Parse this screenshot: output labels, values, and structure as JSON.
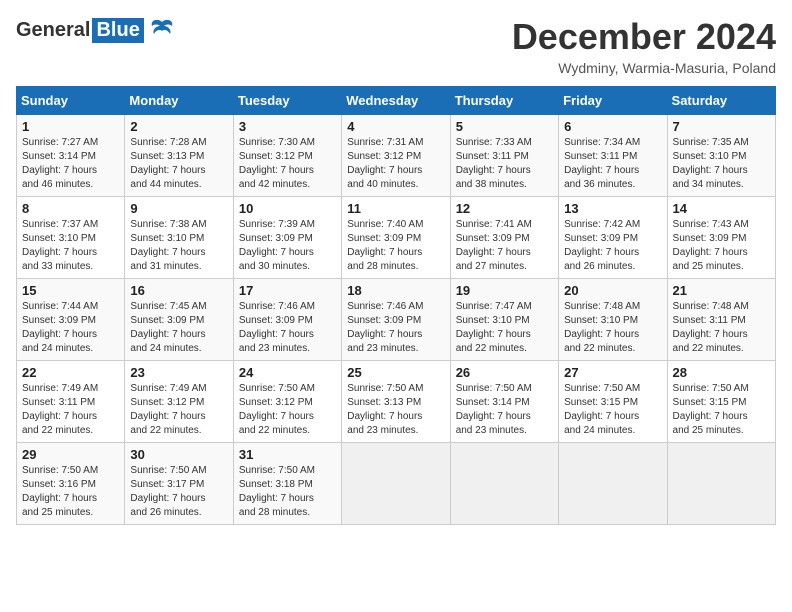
{
  "header": {
    "logo_general": "General",
    "logo_blue": "Blue",
    "month_title": "December 2024",
    "subtitle": "Wydminy, Warmia-Masuria, Poland"
  },
  "days_of_week": [
    "Sunday",
    "Monday",
    "Tuesday",
    "Wednesday",
    "Thursday",
    "Friday",
    "Saturday"
  ],
  "weeks": [
    [
      {
        "day": "1",
        "info": "Sunrise: 7:27 AM\nSunset: 3:14 PM\nDaylight: 7 hours\nand 46 minutes."
      },
      {
        "day": "2",
        "info": "Sunrise: 7:28 AM\nSunset: 3:13 PM\nDaylight: 7 hours\nand 44 minutes."
      },
      {
        "day": "3",
        "info": "Sunrise: 7:30 AM\nSunset: 3:12 PM\nDaylight: 7 hours\nand 42 minutes."
      },
      {
        "day": "4",
        "info": "Sunrise: 7:31 AM\nSunset: 3:12 PM\nDaylight: 7 hours\nand 40 minutes."
      },
      {
        "day": "5",
        "info": "Sunrise: 7:33 AM\nSunset: 3:11 PM\nDaylight: 7 hours\nand 38 minutes."
      },
      {
        "day": "6",
        "info": "Sunrise: 7:34 AM\nSunset: 3:11 PM\nDaylight: 7 hours\nand 36 minutes."
      },
      {
        "day": "7",
        "info": "Sunrise: 7:35 AM\nSunset: 3:10 PM\nDaylight: 7 hours\nand 34 minutes."
      }
    ],
    [
      {
        "day": "8",
        "info": "Sunrise: 7:37 AM\nSunset: 3:10 PM\nDaylight: 7 hours\nand 33 minutes."
      },
      {
        "day": "9",
        "info": "Sunrise: 7:38 AM\nSunset: 3:10 PM\nDaylight: 7 hours\nand 31 minutes."
      },
      {
        "day": "10",
        "info": "Sunrise: 7:39 AM\nSunset: 3:09 PM\nDaylight: 7 hours\nand 30 minutes."
      },
      {
        "day": "11",
        "info": "Sunrise: 7:40 AM\nSunset: 3:09 PM\nDaylight: 7 hours\nand 28 minutes."
      },
      {
        "day": "12",
        "info": "Sunrise: 7:41 AM\nSunset: 3:09 PM\nDaylight: 7 hours\nand 27 minutes."
      },
      {
        "day": "13",
        "info": "Sunrise: 7:42 AM\nSunset: 3:09 PM\nDaylight: 7 hours\nand 26 minutes."
      },
      {
        "day": "14",
        "info": "Sunrise: 7:43 AM\nSunset: 3:09 PM\nDaylight: 7 hours\nand 25 minutes."
      }
    ],
    [
      {
        "day": "15",
        "info": "Sunrise: 7:44 AM\nSunset: 3:09 PM\nDaylight: 7 hours\nand 24 minutes."
      },
      {
        "day": "16",
        "info": "Sunrise: 7:45 AM\nSunset: 3:09 PM\nDaylight: 7 hours\nand 24 minutes."
      },
      {
        "day": "17",
        "info": "Sunrise: 7:46 AM\nSunset: 3:09 PM\nDaylight: 7 hours\nand 23 minutes."
      },
      {
        "day": "18",
        "info": "Sunrise: 7:46 AM\nSunset: 3:09 PM\nDaylight: 7 hours\nand 23 minutes."
      },
      {
        "day": "19",
        "info": "Sunrise: 7:47 AM\nSunset: 3:10 PM\nDaylight: 7 hours\nand 22 minutes."
      },
      {
        "day": "20",
        "info": "Sunrise: 7:48 AM\nSunset: 3:10 PM\nDaylight: 7 hours\nand 22 minutes."
      },
      {
        "day": "21",
        "info": "Sunrise: 7:48 AM\nSunset: 3:11 PM\nDaylight: 7 hours\nand 22 minutes."
      }
    ],
    [
      {
        "day": "22",
        "info": "Sunrise: 7:49 AM\nSunset: 3:11 PM\nDaylight: 7 hours\nand 22 minutes."
      },
      {
        "day": "23",
        "info": "Sunrise: 7:49 AM\nSunset: 3:12 PM\nDaylight: 7 hours\nand 22 minutes."
      },
      {
        "day": "24",
        "info": "Sunrise: 7:50 AM\nSunset: 3:12 PM\nDaylight: 7 hours\nand 22 minutes."
      },
      {
        "day": "25",
        "info": "Sunrise: 7:50 AM\nSunset: 3:13 PM\nDaylight: 7 hours\nand 23 minutes."
      },
      {
        "day": "26",
        "info": "Sunrise: 7:50 AM\nSunset: 3:14 PM\nDaylight: 7 hours\nand 23 minutes."
      },
      {
        "day": "27",
        "info": "Sunrise: 7:50 AM\nSunset: 3:15 PM\nDaylight: 7 hours\nand 24 minutes."
      },
      {
        "day": "28",
        "info": "Sunrise: 7:50 AM\nSunset: 3:15 PM\nDaylight: 7 hours\nand 25 minutes."
      }
    ],
    [
      {
        "day": "29",
        "info": "Sunrise: 7:50 AM\nSunset: 3:16 PM\nDaylight: 7 hours\nand 25 minutes."
      },
      {
        "day": "30",
        "info": "Sunrise: 7:50 AM\nSunset: 3:17 PM\nDaylight: 7 hours\nand 26 minutes."
      },
      {
        "day": "31",
        "info": "Sunrise: 7:50 AM\nSunset: 3:18 PM\nDaylight: 7 hours\nand 28 minutes."
      },
      {
        "day": "",
        "info": ""
      },
      {
        "day": "",
        "info": ""
      },
      {
        "day": "",
        "info": ""
      },
      {
        "day": "",
        "info": ""
      }
    ]
  ]
}
